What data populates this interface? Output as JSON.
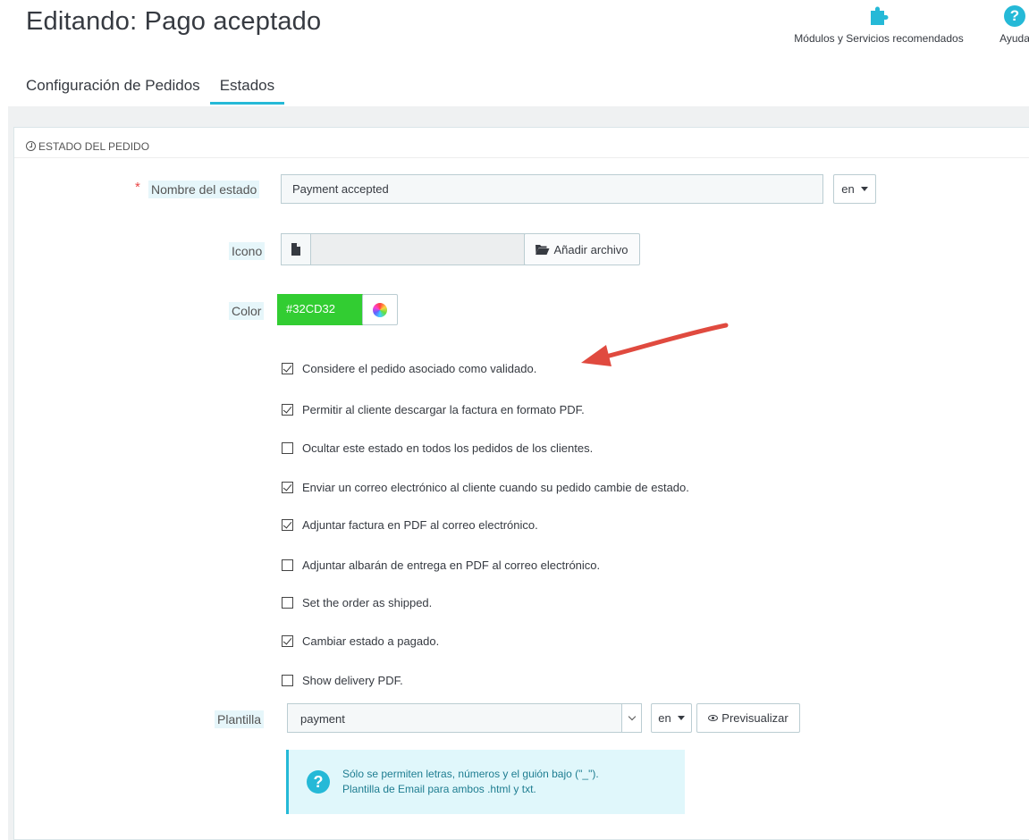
{
  "header": {
    "title": "Editando: Pago aceptado",
    "toolbar": {
      "modules_label": "Módulos y Servicios recomendados",
      "help_label": "Ayuda"
    }
  },
  "tabs": [
    {
      "label": "Configuración de Pedidos",
      "active": false
    },
    {
      "label": "Estados",
      "active": true
    }
  ],
  "panel": {
    "heading": "ESTADO DEL PEDIDO",
    "fields": {
      "name": {
        "label": "Nombre del estado",
        "required_mark": "*",
        "value": "Payment accepted",
        "lang": "en"
      },
      "icon": {
        "label": "Icono",
        "button": "Añadir archivo"
      },
      "color": {
        "label": "Color",
        "value": "#32CD32"
      },
      "checkboxes": [
        {
          "label": "Considere el pedido asociado como validado.",
          "checked": true
        },
        {
          "label": "Permitir al cliente descargar la factura en formato PDF.",
          "checked": true
        },
        {
          "label": "Ocultar este estado en todos los pedidos de los clientes.",
          "checked": false
        },
        {
          "label": "Enviar un correo electrónico al cliente cuando su pedido cambie de estado.",
          "checked": true
        },
        {
          "label": "Adjuntar factura en PDF al correo electrónico.",
          "checked": true
        },
        {
          "label": "Adjuntar albarán de entrega en PDF al correo electrónico.",
          "checked": false
        },
        {
          "label": "Set the order as shipped.",
          "checked": false
        },
        {
          "label": "Cambiar estado a pagado.",
          "checked": true
        },
        {
          "label": "Show delivery PDF.",
          "checked": false
        }
      ],
      "template": {
        "label": "Plantilla",
        "value": "payment",
        "lang": "en",
        "preview_button": "Previsualizar"
      }
    },
    "info": {
      "line1": "Sólo se permiten letras, números y el guión bajo (\"_\").",
      "line2": "Plantilla de Email para ambos .html y txt."
    }
  },
  "colors": {
    "accent": "#25b9d7",
    "swatch": "#32CD32",
    "annotation_arrow": "#e04a3f"
  }
}
